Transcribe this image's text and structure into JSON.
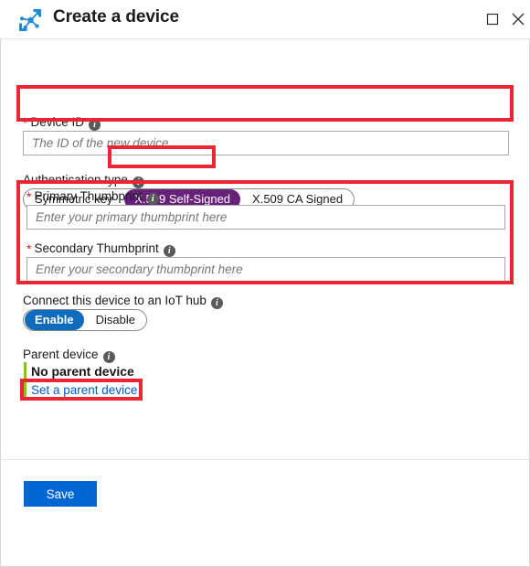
{
  "window": {
    "title": "Create a device",
    "app_icon": "iot-device-icon",
    "maximize_icon": "maximize-icon",
    "close_icon": "close-icon"
  },
  "form": {
    "device_id": {
      "label": "Device ID",
      "required": true,
      "info_icon": "info-icon",
      "value": "",
      "placeholder": "The ID of the new device"
    },
    "authentication_type": {
      "label": "Authentication type",
      "info_icon": "info-icon",
      "options": [
        {
          "label": "Symmetric key",
          "selected": false
        },
        {
          "label": "X.509 Self-Signed",
          "selected": true
        },
        {
          "label": "X.509 CA Signed",
          "selected": false
        }
      ]
    },
    "primary_thumbprint": {
      "label": "Primary Thumbprint",
      "required": true,
      "info_icon": "info-icon",
      "value": "",
      "placeholder": "Enter your primary thumbprint here"
    },
    "secondary_thumbprint": {
      "label": "Secondary Thumbprint",
      "required": true,
      "info_icon": "info-icon",
      "value": "",
      "placeholder": "Enter your secondary thumbprint here"
    },
    "connect_to_hub": {
      "label": "Connect this device to an IoT hub",
      "info_icon": "info-icon",
      "options": [
        {
          "label": "Enable",
          "selected": true
        },
        {
          "label": "Disable",
          "selected": false
        }
      ]
    },
    "parent_device": {
      "label": "Parent device",
      "info_icon": "info-icon",
      "status": "No parent device",
      "link": "Set a parent device",
      "accent_color": "#8cbf26"
    }
  },
  "footer": {
    "save_label": "Save"
  },
  "annotations": {
    "colors": {
      "highlight": "#ec2434",
      "selected_auth": "#68217a",
      "selected_toggle": "#0f6cbd",
      "primary_button": "#0067d5",
      "link": "#005cc8",
      "required_star": "#e81123"
    },
    "boxes": [
      {
        "name": "device-id-highlight"
      },
      {
        "name": "auth-pill-highlight"
      },
      {
        "name": "thumbprints-highlight"
      },
      {
        "name": "set-parent-highlight"
      }
    ]
  }
}
